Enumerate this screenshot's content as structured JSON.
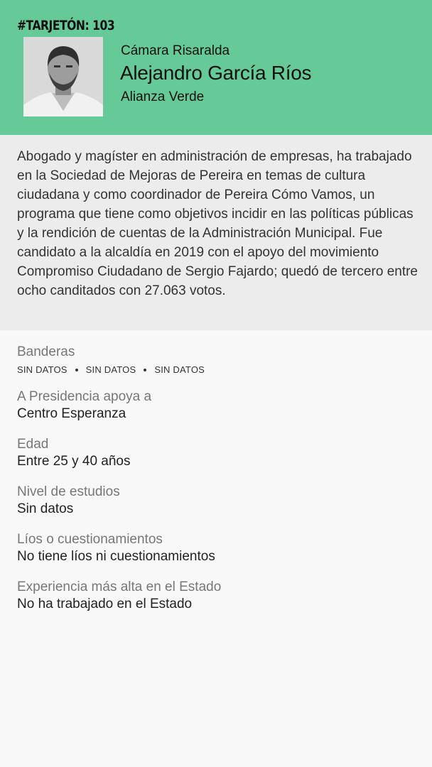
{
  "header": {
    "tag": "#TARJETÓN: 103",
    "chamber": "Cámara Risaralda",
    "name": "Alejandro García Ríos",
    "party": "Alianza Verde",
    "background_color": "#66c998"
  },
  "bio": {
    "text": "Abogado y magíster en administración de empresas, ha trabajado en la Sociedad de Mejoras de Pereira en temas de cultura ciudadana y como coordinador de Pereira Cómo Vamos, un programa que tiene como objetivos incidir en las políticas públicas y la rendición de cuentas de la Administración Municipal. Fue candidato a la alcaldía en 2019 con el apoyo del movimiento Compromiso Ciudadano de Sergio Fajardo; quedó de tercero entre ocho canditados con 27.063 votos."
  },
  "details": {
    "flags_label": "Banderas",
    "flags": [
      "SIN DATOS",
      "SIN DATOS",
      "SIN DATOS"
    ],
    "presidency_label": "A Presidencia apoya a",
    "presidency_value": "Centro Esperanza",
    "age_label": "Edad",
    "age_value": "Entre 25 y 40 años",
    "education_label": "Nivel de estudios",
    "education_value": "Sin datos",
    "issues_label": "Líos o cuestionamientos",
    "issues_value": "No tiene líos ni cuestionamientos",
    "experience_label": "Experiencia más alta en el Estado",
    "experience_value": "No ha trabajado en el Estado"
  }
}
